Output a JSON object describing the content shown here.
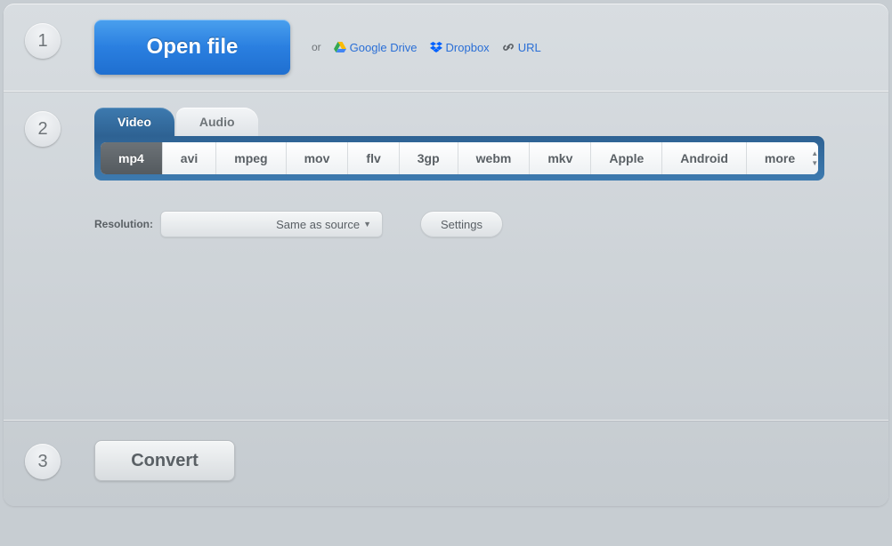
{
  "step1": {
    "badge": "1",
    "open_label": "Open file",
    "or_text": "or",
    "sources": {
      "gdrive": "Google Drive",
      "dropbox": "Dropbox",
      "url": "URL"
    }
  },
  "step2": {
    "badge": "2",
    "tabs": {
      "video": "Video",
      "audio": "Audio"
    },
    "formats": [
      "mp4",
      "avi",
      "mpeg",
      "mov",
      "flv",
      "3gp",
      "webm",
      "mkv",
      "Apple",
      "Android",
      "more"
    ],
    "active_format": "mp4",
    "resolution_label": "Resolution:",
    "resolution_value": "Same as source",
    "settings_label": "Settings"
  },
  "step3": {
    "badge": "3",
    "convert_label": "Convert"
  }
}
